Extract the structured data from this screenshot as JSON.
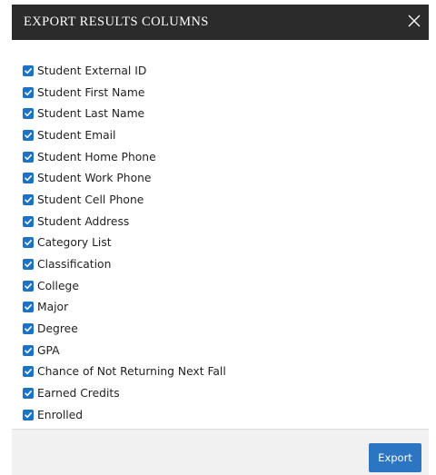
{
  "dialog": {
    "title": "EXPORT RESULTS COLUMNS",
    "close_icon": "close-icon"
  },
  "columns": [
    {
      "label": "Student External ID",
      "checked": true
    },
    {
      "label": "Student First Name",
      "checked": true
    },
    {
      "label": "Student Last Name",
      "checked": true
    },
    {
      "label": "Student Email",
      "checked": true
    },
    {
      "label": "Student Home Phone",
      "checked": true
    },
    {
      "label": "Student Work Phone",
      "checked": true
    },
    {
      "label": "Student Cell Phone",
      "checked": true
    },
    {
      "label": "Student Address",
      "checked": true
    },
    {
      "label": "Category List",
      "checked": true
    },
    {
      "label": "Classification",
      "checked": true
    },
    {
      "label": "College",
      "checked": true
    },
    {
      "label": "Major",
      "checked": true
    },
    {
      "label": "Degree",
      "checked": true
    },
    {
      "label": "GPA",
      "checked": true
    },
    {
      "label": "Chance of Not Returning Next Fall",
      "checked": true
    },
    {
      "label": "Earned Credits",
      "checked": true
    },
    {
      "label": "Enrolled",
      "checked": true
    }
  ],
  "footer": {
    "export_label": "Export"
  },
  "colors": {
    "header_bg": "#2b2b2b",
    "checkbox": "#1a73c8",
    "export_button": "#2b75c2",
    "footer_bg": "#f1f1f1"
  }
}
